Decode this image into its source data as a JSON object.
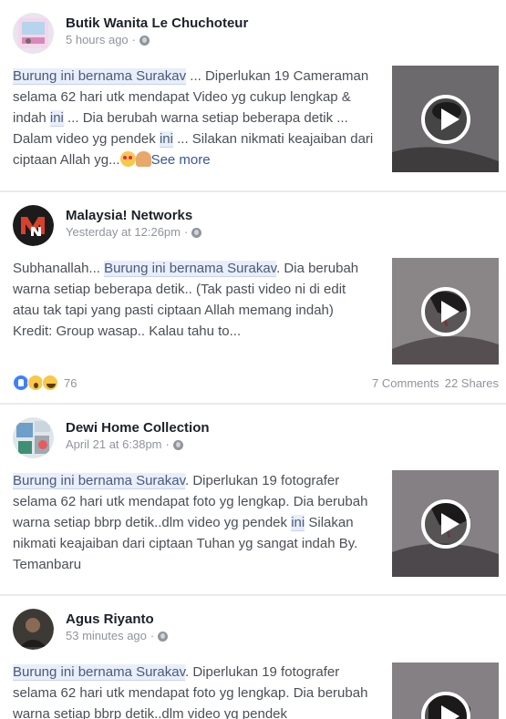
{
  "posts": [
    {
      "author": "Butik Wanita Le Chuchoteur",
      "time": "5 hours ago",
      "text": {
        "part1": "Burung ini bernama Surakav",
        "part2": " ... Diperlukan 19 Cameraman selama 62 hari utk mendapat Video yg cukup lengkap & indah ",
        "part3": "ini",
        "part4": " ... Dia berubah warna setiap beberapa detik ... Dalam video yg pendek ",
        "part5": "ini",
        "part6": " ... Silakan nikmati keajaiban dari ciptaan Allah yg...",
        "see_more": "See more"
      }
    },
    {
      "author": "Malaysia! Networks",
      "time": "Yesterday at 12:26pm",
      "text": {
        "part1": "Subhanallah... ",
        "part2": "Burung ini bernama Surakav",
        "part3": ". Dia berubah warna setiap beberapa detik.. (Tak pasti video ni di edit atau tak tapi yang pasti ciptaan Allah memang indah) Kredit: Group wasap.. Kalau tahu to..."
      },
      "reactions_count": "76",
      "comments": "7 Comments",
      "shares": "22 Shares"
    },
    {
      "author": "Dewi Home Collection",
      "time": "April 21 at 6:38pm",
      "text": {
        "part1": "Burung ini bernama Surakav",
        "part2": ". Diperlukan 19 fotografer selama 62 hari utk mendapat foto yg lengkap. Dia berubah warna setiap bbrp detik..dlm video yg pendek ",
        "part3": "ini",
        "part4": " Silakan nikmati keajaiban dari ciptaan Tuhan yg sangat indah By. Temanbaru"
      }
    },
    {
      "author": "Agus Riyanto",
      "time": "53 minutes ago",
      "text": {
        "part1": "Burung ini bernama Surakav",
        "part2": ". Diperlukan 19 fotografer selama 62 hari utk mendapat foto yg lengkap. Dia berubah warna setiap bbrp detik..dlm video yg pendek"
      }
    }
  ],
  "icons": {
    "globe": "globe-icon",
    "play": "play-icon",
    "like": "like-icon",
    "wow": "wow-icon",
    "haha": "haha-icon"
  },
  "colors": {
    "highlight": "#e8eefa",
    "link": "#365899",
    "muted": "#90949c"
  }
}
